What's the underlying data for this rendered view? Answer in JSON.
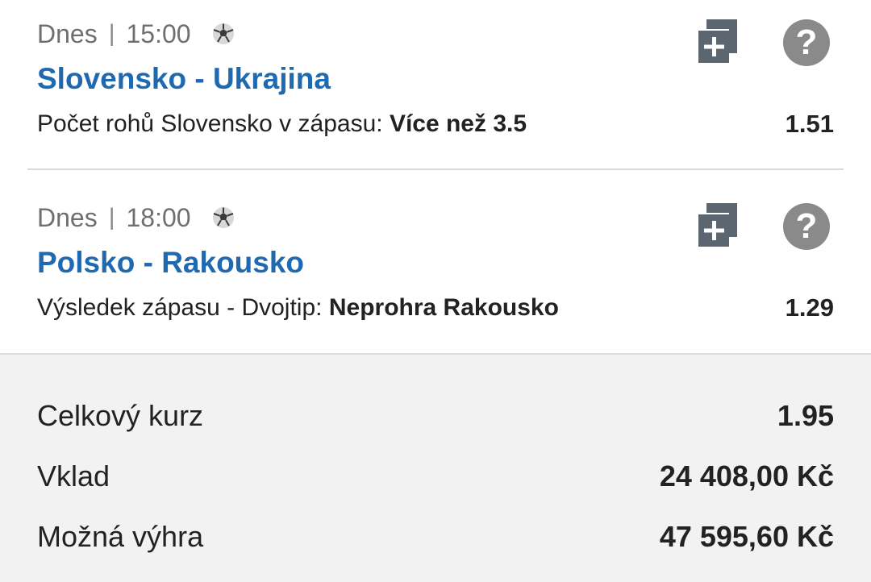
{
  "bets": [
    {
      "day": "Dnes",
      "separator": "|",
      "time": "15:00",
      "sport_icon": "soccer-ball-icon",
      "match": "Slovensko - Ukrajina",
      "market": "Počet rohů Slovensko v zápasu:",
      "pick": "Více než 3.5",
      "odds": "1.51",
      "add_icon": "add-to-slip-icon",
      "help_icon": "help-icon",
      "help_symbol": "?"
    },
    {
      "day": "Dnes",
      "separator": "|",
      "time": "18:00",
      "sport_icon": "soccer-ball-icon",
      "match": "Polsko - Rakousko",
      "market": "Výsledek zápasu - Dvojtip:",
      "pick": "Neprohra Rakousko",
      "odds": "1.29",
      "add_icon": "add-to-slip-icon",
      "help_icon": "help-icon",
      "help_symbol": "?"
    }
  ],
  "summary": {
    "total_odds_label": "Celkový kurz",
    "total_odds_value": "1.95",
    "stake_label": "Vklad",
    "stake_value": "24 408,00 Kč",
    "win_label": "Možná výhra",
    "win_value": "47 595,60 Kč"
  },
  "colors": {
    "match_link": "#1f69b0",
    "icon_gray": "#5c6670",
    "help_gray": "#8a8a8a",
    "summary_bg": "#f2f2f2"
  }
}
